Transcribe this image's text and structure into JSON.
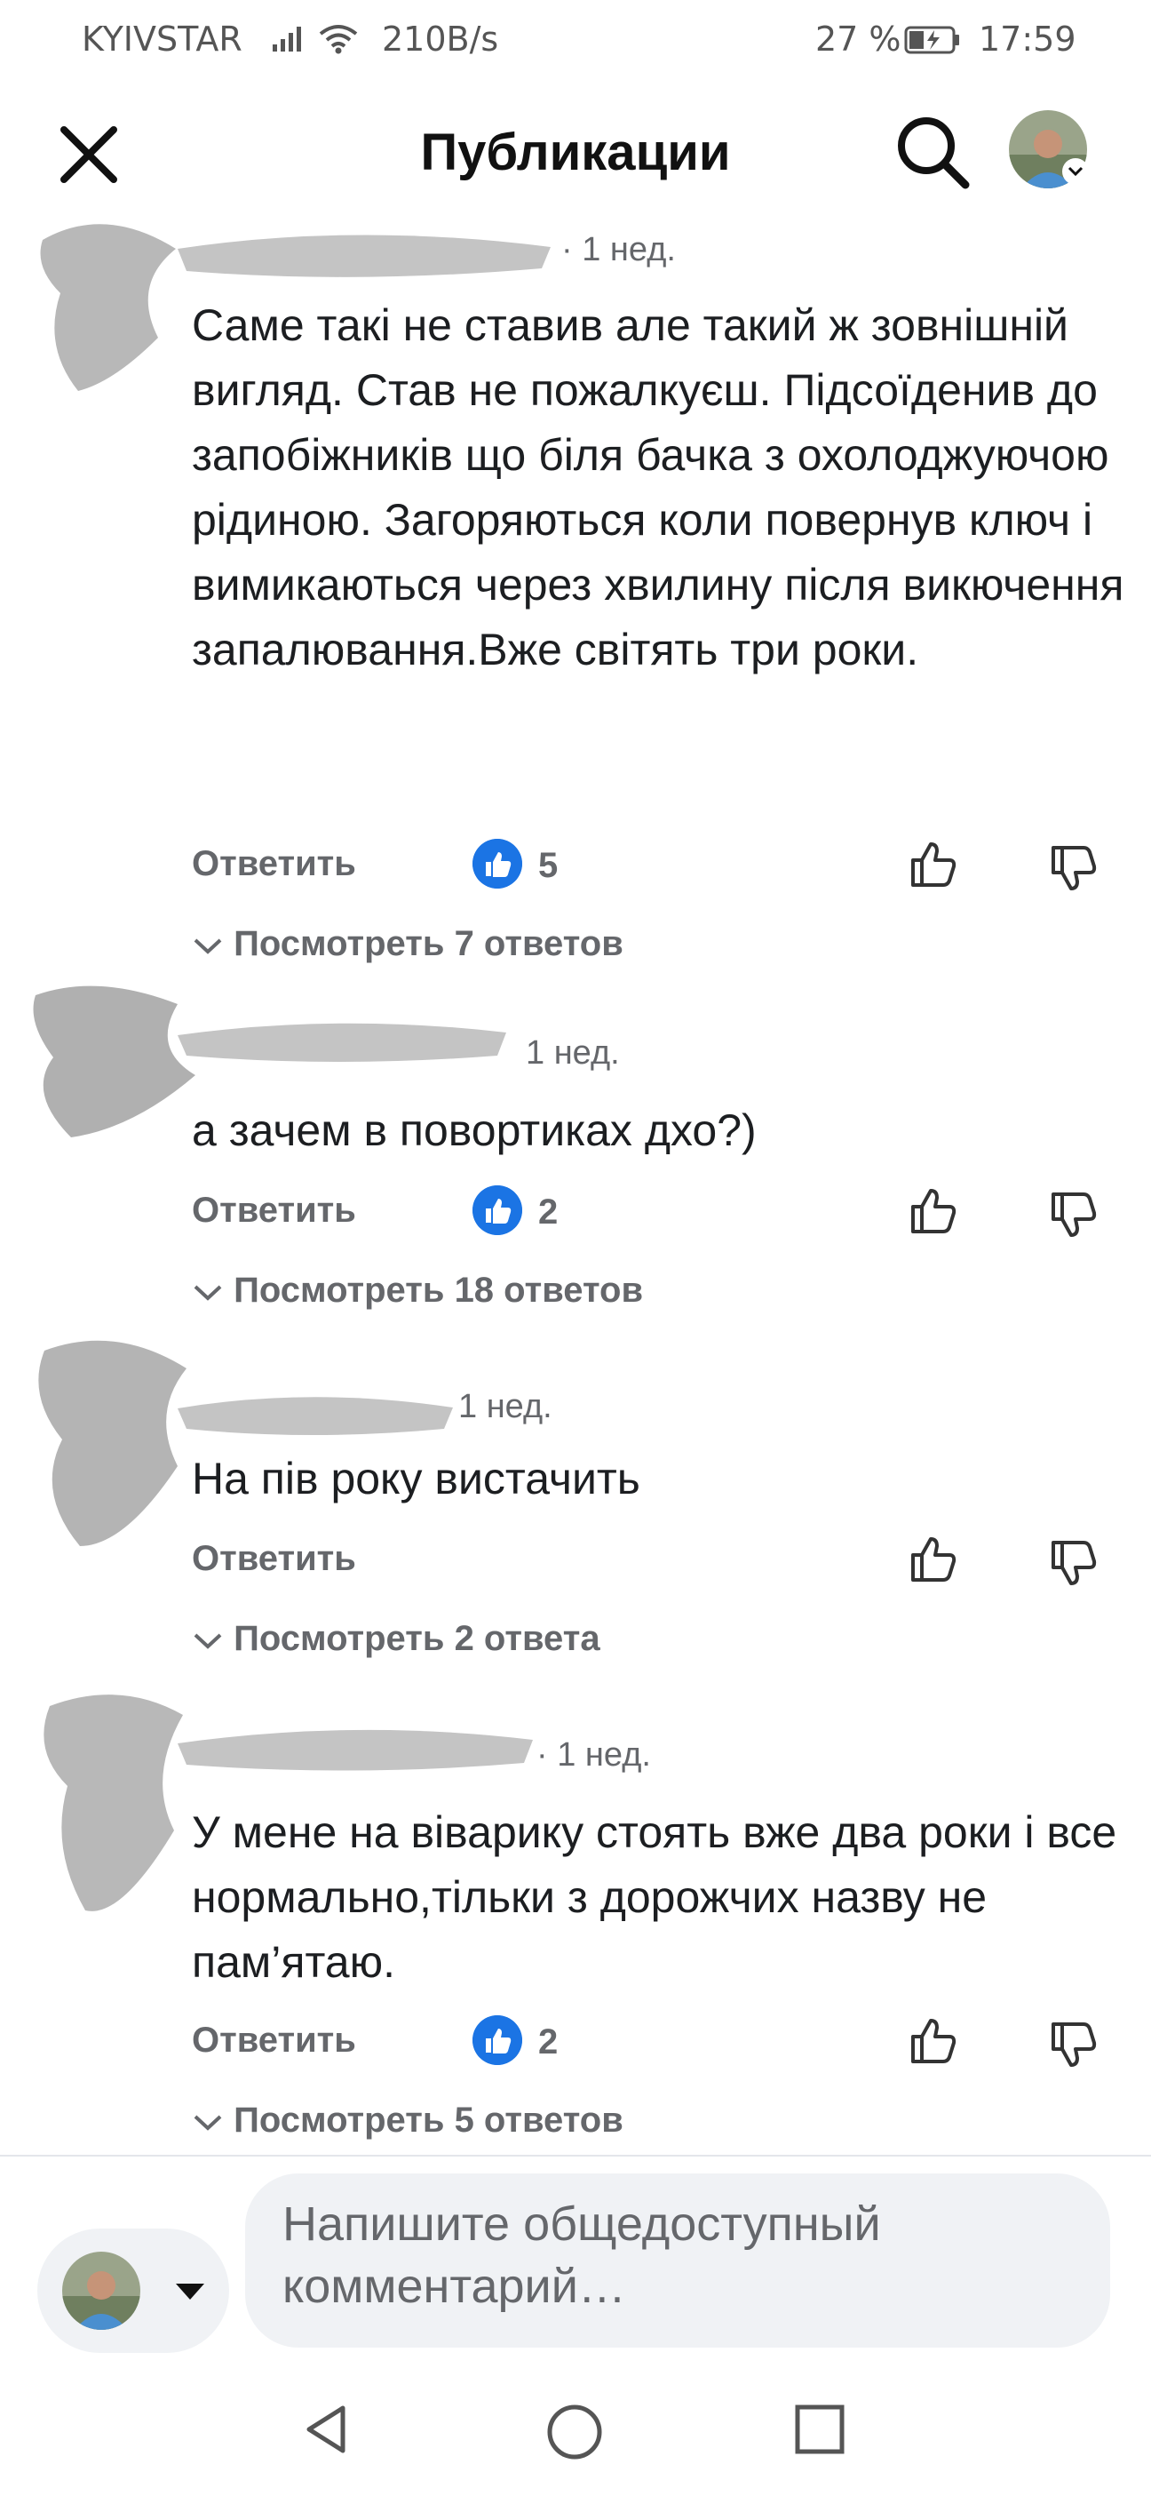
{
  "status_bar": {
    "carrier": "KYIVSTAR",
    "network_speed": "210B/s",
    "battery_percent": "27 %",
    "time": "17:59",
    "icons": [
      "signal-icon",
      "wifi-icon",
      "battery-charging-icon"
    ]
  },
  "header": {
    "title": "Публикации",
    "icons": [
      "close-icon",
      "search-icon",
      "avatar"
    ]
  },
  "comments": [
    {
      "time": "· 1 нед.",
      "body": "Саме такі не ставив але такий ж зовнішній вигляд. Став не пожалкуєш. Підсоїденив до запобіжників  що біля бачка з охолоджуючою рідиною. Загоряються коли повернув ключ і вимикаються через хвилину після викючення запалювання.Вже світять три роки.",
      "reply_label": "Ответить",
      "reaction_count": "5",
      "view_replies": "Посмотреть 7 ответов"
    },
    {
      "time": "1 нед.",
      "body": "а зачем в повортиках дхо?)",
      "reply_label": "Ответить",
      "reaction_count": "2",
      "view_replies": "Посмотреть 18 ответов"
    },
    {
      "time": "1 нед.",
      "body": "На пів року вистачить",
      "reply_label": "Ответить",
      "reaction_count": "",
      "view_replies": "Посмотреть 2 ответа"
    },
    {
      "time": "· 1 нед.",
      "body": "У мене на віварику стоять вже два роки і все нормально,тільки з дорожчих назву не пам’ятаю.",
      "reply_label": "Ответить",
      "reaction_count": "2",
      "view_replies": "Посмотреть 5 ответов"
    }
  ],
  "composer": {
    "placeholder": "Напишите общедоступный комментарий…"
  },
  "nav_bar": {
    "icons": [
      "back-icon",
      "home-icon",
      "recent-apps-icon"
    ]
  },
  "colors": {
    "like_blue": "#1b74e4",
    "secondary_text": "#65676b",
    "composer_bg": "#f0f2f5"
  }
}
